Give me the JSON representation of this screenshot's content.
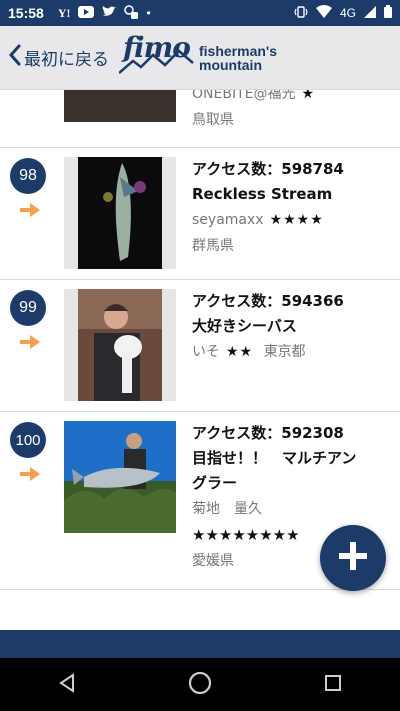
{
  "status_bar": {
    "time": "15:58",
    "left_icons": [
      "yahoo-icon",
      "youtube-icon",
      "twitter-icon",
      "notification-icon",
      "dot-icon"
    ],
    "network": "4G"
  },
  "header": {
    "back_label": "最初に戻る",
    "logo_mark": "fimo",
    "logo_line1": "fisherman's",
    "logo_line2": "mountain"
  },
  "items": [
    {
      "rank": "",
      "access": "",
      "title": "",
      "user": "ONEBITE@福光",
      "stars": "★",
      "prefecture": "鳥取県"
    },
    {
      "rank": "98",
      "access": "アクセス数：598784",
      "title": "Reckless Stream",
      "user": "seyamaxx",
      "stars": "★★★★",
      "prefecture": "群馬県"
    },
    {
      "rank": "99",
      "access": "アクセス数：594366",
      "title": "大好きシーバス",
      "user": "いそ",
      "stars": "★★",
      "prefecture": "東京都"
    },
    {
      "rank": "100",
      "access": "アクセス数：592308",
      "title_line1": "目指せ！！　マルチアン",
      "title_line2": "グラー",
      "user": "菊地　量久",
      "stars": "★★★★★★★★",
      "prefecture": "愛媛県"
    }
  ],
  "colors": {
    "brand": "#1c3b68",
    "arrow": "#f5a04a"
  }
}
